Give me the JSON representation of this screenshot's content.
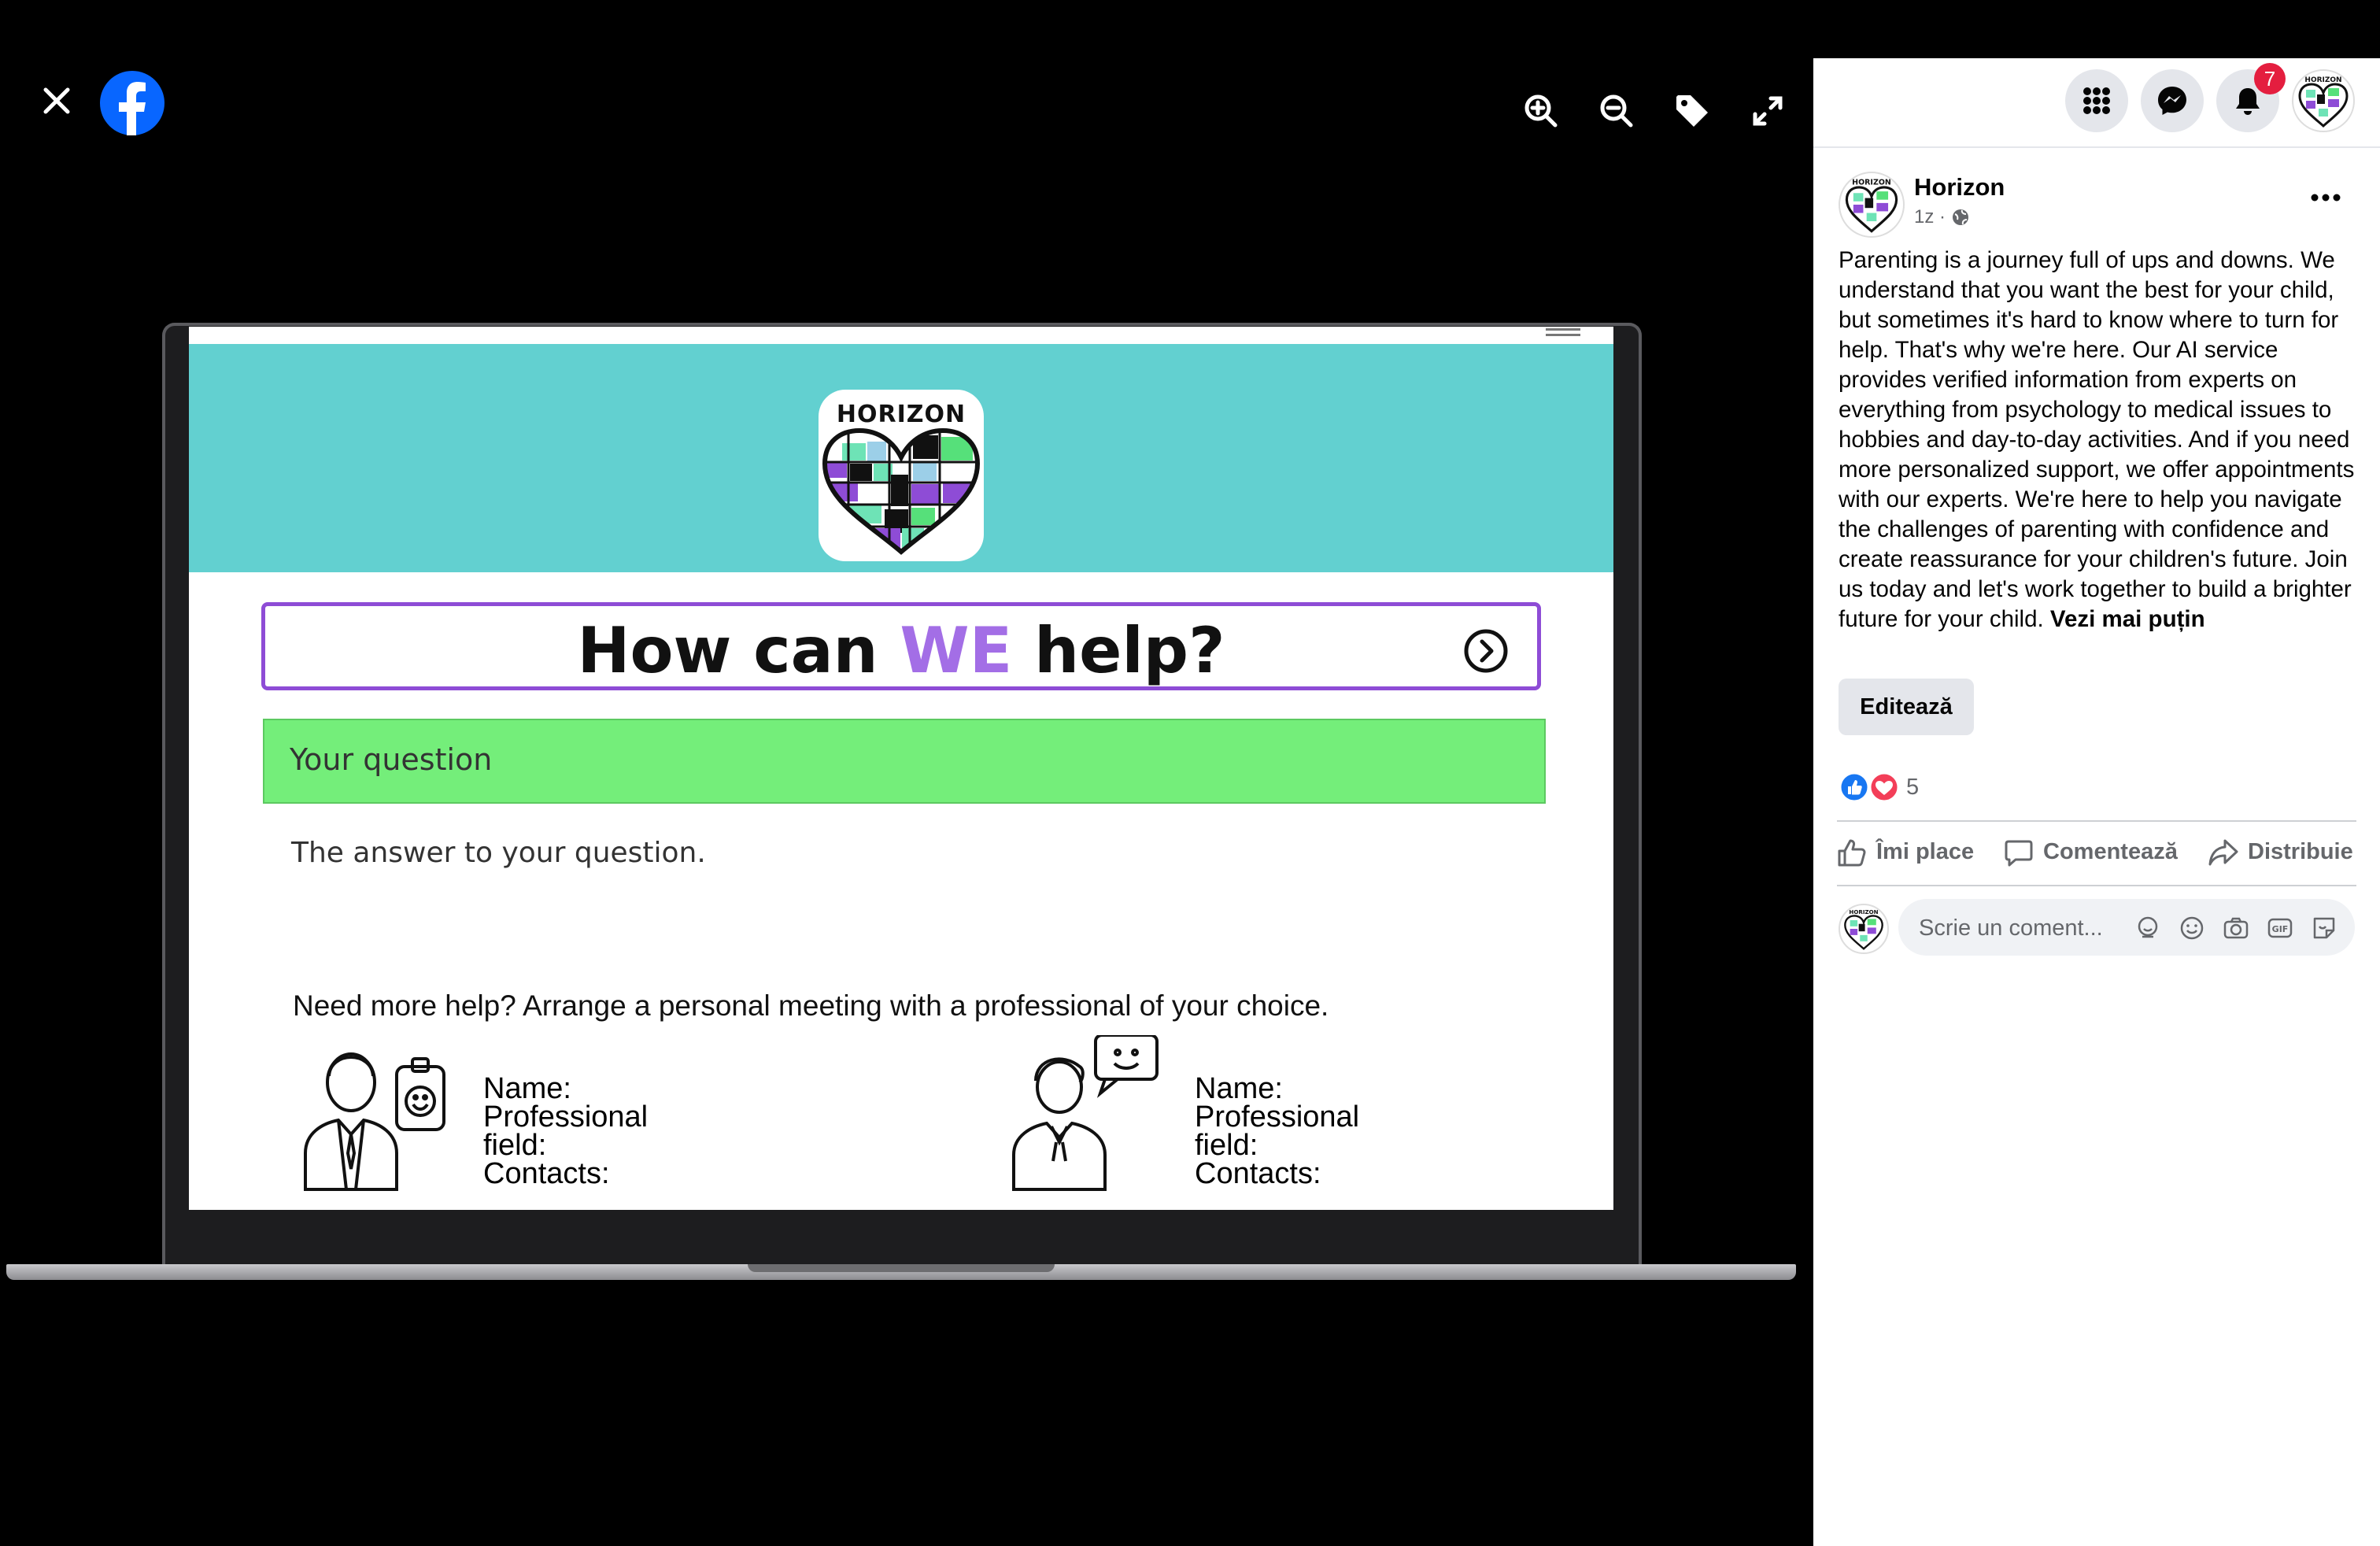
{
  "viewer": {
    "icons": [
      "close-icon",
      "facebook-logo",
      "zoom-in-icon",
      "zoom-out-icon",
      "tag-icon",
      "fullscreen-icon"
    ]
  },
  "slide": {
    "brand": "HORIZON",
    "heading_pre": "How can ",
    "heading_we": "WE",
    "heading_post": " help?",
    "question_placeholder": "Your question",
    "answer": "The answer to your question.",
    "meeting_prompt": "Need more help? Arrange a personal meeting with a professional of your choice.",
    "experts": [
      {
        "name_label": "Name:",
        "field_label": "Professional field:",
        "contacts_label": "Contacts:"
      },
      {
        "name_label": "Name:",
        "field_label": "Professional field:",
        "contacts_label": "Contacts:"
      }
    ],
    "colors": {
      "teal": "#62d0d0",
      "purple": "#8e4cd6",
      "green": "#74ee7a"
    }
  },
  "topbar": {
    "notification_count": "7",
    "icons": [
      "menu-grid-icon",
      "messenger-icon",
      "bell-icon"
    ]
  },
  "post": {
    "page_name": "Horizon",
    "time": "1z ·",
    "body": "Parenting is a journey full of ups and downs. We understand that you want the best for your child, but sometimes it's hard to know where to turn for help. That's why we're here. Our AI service provides verified information from experts on everything from psychology to medical issues to hobbies and day-to-day activities. And if you need more personalized support, we offer appointments with our experts. We're here to help you navigate the challenges of parenting with confidence and create reassurance for your children's future. Join us today and let's work together to build a brighter future for your child.",
    "see_less": "Vezi mai puțin",
    "edit_label": "Editează",
    "reaction_count": "5",
    "actions": {
      "like": "Îmi place",
      "comment": "Comentează",
      "share": "Distribuie"
    },
    "comment_placeholder": "Scrie un coment..."
  },
  "accent_colors": {
    "facebook_blue": "#0866ff",
    "like_blue": "#1877f2",
    "love_red": "#f33e58",
    "badge_red": "#e41e3f"
  }
}
